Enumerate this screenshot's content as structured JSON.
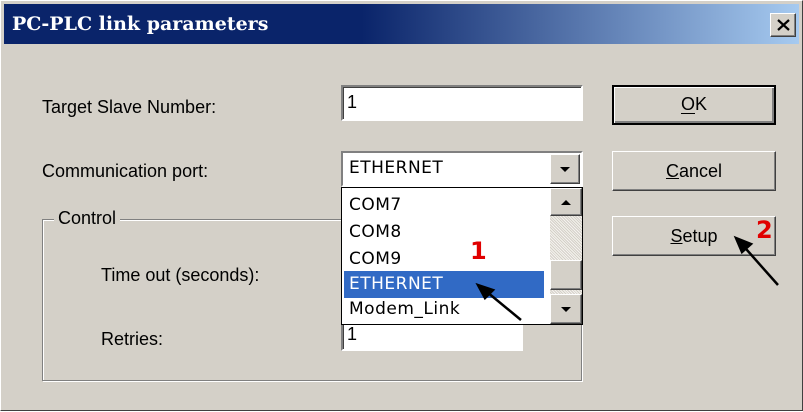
{
  "window": {
    "title": "PC-PLC link parameters"
  },
  "fields": {
    "target_slave_label": "Target Slave Number:",
    "target_slave_value": "1",
    "comm_port_label": "Communication port:",
    "comm_port_value": "ETHERNET",
    "control_group_label": "Control",
    "timeout_label": "Time out (seconds):",
    "retries_label": "Retries:",
    "retries_value": "1"
  },
  "buttons": {
    "ok": "OK",
    "cancel": "Cancel",
    "setup": "Setup"
  },
  "dropdown": {
    "options": [
      "COM7",
      "COM8",
      "COM9",
      "ETHERNET",
      "Modem_Link"
    ],
    "selected_index": 3
  },
  "annotations": {
    "step1": "1",
    "step2": "2",
    "color": "#e00000"
  },
  "colors": {
    "titlebar_start": "#0a246a",
    "titlebar_end": "#a6caf0",
    "dialog_face": "#d4d0c8",
    "selection": "#316ac5"
  }
}
